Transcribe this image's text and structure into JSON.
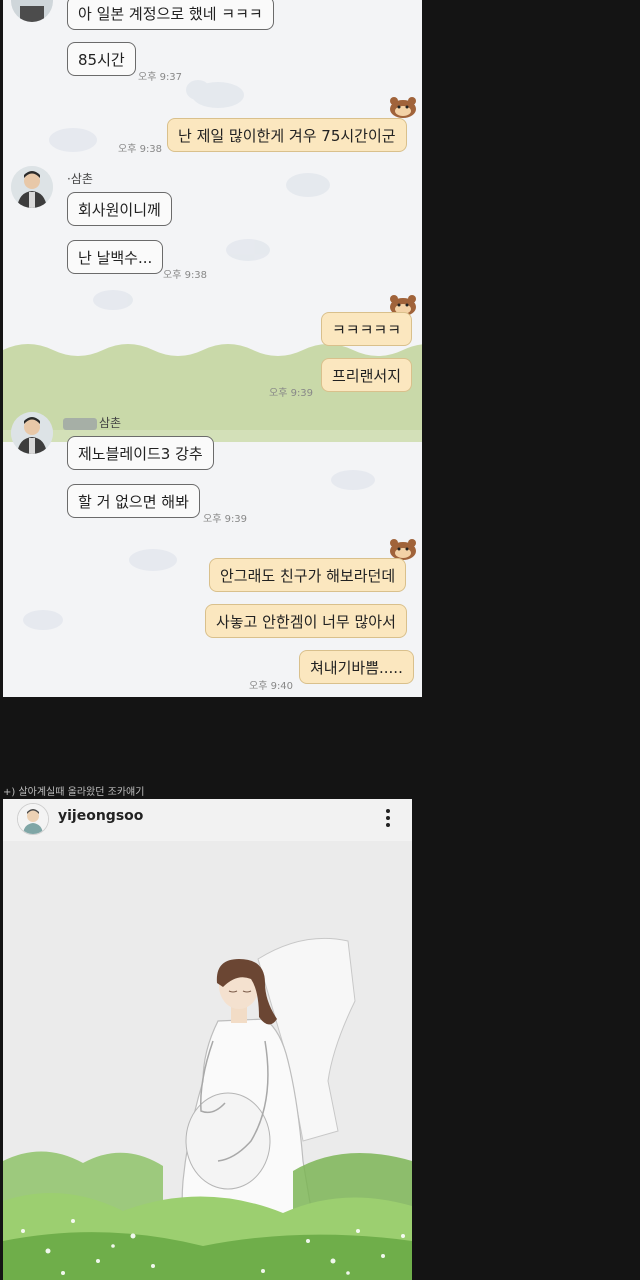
{
  "chat": {
    "messages": [
      {
        "id": "m1",
        "text": "아 일본 계정으로 했네 ㅋㅋㅋ"
      },
      {
        "id": "m2",
        "text": "85시간",
        "time": "오후 9:37"
      },
      {
        "id": "m3",
        "text": "난 제일 많이한게 겨우 75시간이군",
        "time": "오후 9:38"
      },
      {
        "id": "m4",
        "sender": "·삼촌",
        "text": "회사원이니께"
      },
      {
        "id": "m5",
        "text": "난 날백수...",
        "time": "오후 9:38"
      },
      {
        "id": "m6",
        "text": "ㅋㅋㅋㅋㅋ"
      },
      {
        "id": "m7",
        "text": "프리랜서지",
        "time": "오후 9:39"
      },
      {
        "id": "m8",
        "sender": "삼촌",
        "text": "제노블레이드3 강추"
      },
      {
        "id": "m9",
        "text": "할 거 없으면 해봐",
        "time": "오후 9:39"
      },
      {
        "id": "m10",
        "text": "안그래도 친구가 해보라던데"
      },
      {
        "id": "m11",
        "text": "사놓고 안한겜이 너무 많아서"
      },
      {
        "id": "m12",
        "text": "쳐내기바쁨.....",
        "time": "오후 9:40"
      }
    ]
  },
  "caption": "+) 살아계실때 올라왔던 조카얘기",
  "instagram": {
    "username": "yijeongsoo",
    "more_icon": "more-vertical-icon",
    "image": "pregnant-woman-in-wedding-dress-illustration"
  }
}
